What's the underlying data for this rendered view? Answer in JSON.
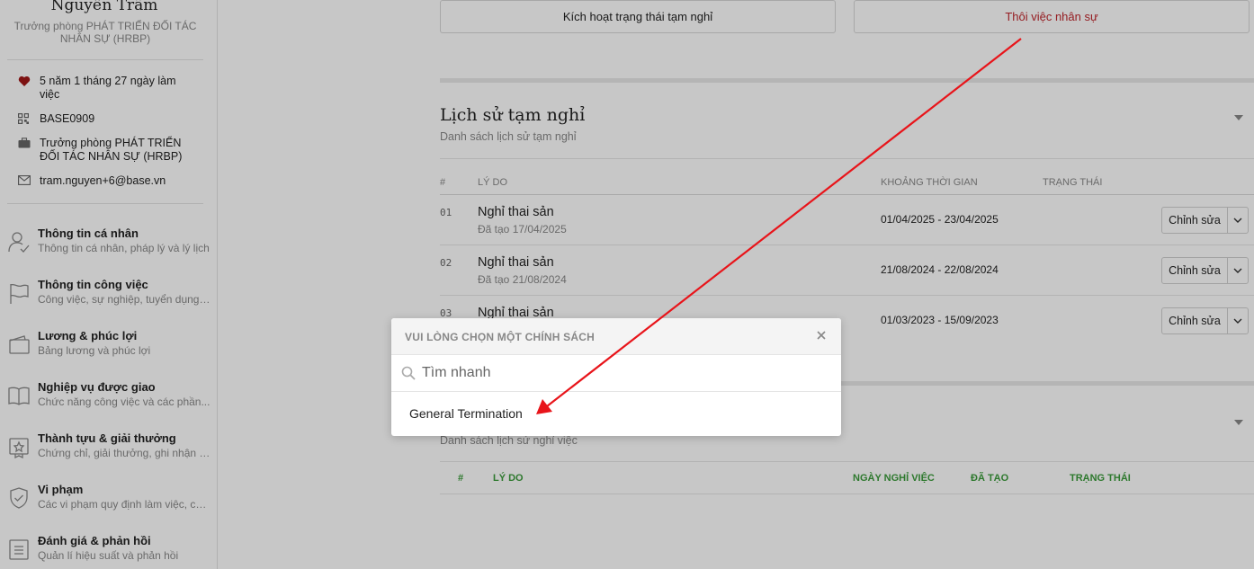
{
  "profile": {
    "name": "Nguyễn Trâm",
    "title": "Trưởng phòng PHÁT TRIỂN ĐỐI TÁC NHÂN SỰ (HRBP)",
    "tenure": "5 năm 1 tháng 27 ngày làm việc",
    "code": "BASE0909",
    "position": "Trưởng phòng PHÁT TRIỂN ĐỐI TÁC NHÂN SỰ (HRBP)",
    "email": "tram.nguyen+6@base.vn"
  },
  "nav": [
    {
      "label": "Thông tin cá nhân",
      "sub": "Thông tin cá nhân, pháp lý và lý lịch",
      "icon": "user-check-icon"
    },
    {
      "label": "Thông tin công việc",
      "sub": "Công việc, sự nghiệp, tuyển dụng ...",
      "icon": "flag-icon"
    },
    {
      "label": "Lương & phúc lợi",
      "sub": "Bảng lương và phúc lợi",
      "icon": "wallet-icon"
    },
    {
      "label": "Nghiệp vụ được giao",
      "sub": "Chức năng công việc và các phần...",
      "icon": "book-icon"
    },
    {
      "label": "Thành tựu & giải thưởng",
      "sub": "Chứng chỉ, giải thưởng, ghi nhận v...",
      "icon": "award-star-icon"
    },
    {
      "label": "Vi phạm",
      "sub": "Các vi phạm quy định làm việc, ch...",
      "icon": "shield-check-icon"
    },
    {
      "label": "Đánh giá & phản hồi",
      "sub": "Quản lí hiệu suất và phản hồi",
      "icon": "list-doc-icon"
    }
  ],
  "actions": {
    "activate_leave": "Kích hoạt trạng thái tạm nghỉ",
    "terminate": "Thôi việc nhân sự",
    "terminate_color": "#c0272d"
  },
  "leave_history": {
    "title": "Lịch sử tạm nghỉ",
    "subtitle": "Danh sách lịch sử tạm nghỉ",
    "columns": {
      "num": "#",
      "reason": "LÝ DO",
      "period": "KHOẢNG THỜI GIAN",
      "status": "TRẠNG THÁI"
    },
    "rows": [
      {
        "num": "01",
        "reason": "Nghỉ thai sản",
        "created": "Đã tạo 17/04/2025",
        "period": "01/04/2025 - 23/04/2025",
        "action": "Chỉnh sửa"
      },
      {
        "num": "02",
        "reason": "Nghỉ thai sản",
        "created": "Đã tạo 21/08/2024",
        "period": "21/08/2024 - 22/08/2024",
        "action": "Chỉnh sửa"
      },
      {
        "num": "03",
        "reason": "Nghỉ thai sản",
        "created": "",
        "period": "01/03/2023 - 15/09/2023",
        "action": "Chỉnh sửa"
      }
    ]
  },
  "termination_history": {
    "subtitle": "Danh sách lịch sử nghỉ việc",
    "columns": {
      "num": "#",
      "reason": "LÝ DO",
      "date": "NGÀY NGHỈ VIỆC",
      "created": "ĐÃ TẠO",
      "status": "TRẠNG THÁI"
    }
  },
  "modal": {
    "title": "VUI LÒNG CHỌN MỘT CHÍNH SÁCH",
    "search_placeholder": "Tìm nhanh",
    "options": [
      "General Termination"
    ]
  },
  "annotation_color": "#e8141a"
}
